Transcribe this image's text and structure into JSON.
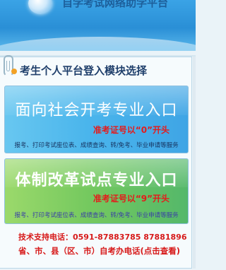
{
  "header": {
    "banner_text": "自学考试网络助学平台"
  },
  "page": {
    "title": "考生个人平台登入模块选择"
  },
  "modules": [
    {
      "title": "面向社会开考专业入口",
      "hint": "准考证号以“0”开头",
      "services": "报考、打印考试座位表、成绩查询、转/免考、毕业申请等服务"
    },
    {
      "title": "体制改革试点专业入口",
      "hint": "准考证号以“9”开头",
      "services": "报考、打印考试座位表、成绩查询、转/免考、毕业申请等服务"
    }
  ],
  "footer": {
    "support": "技术支持电话：0591-87883785 87881896",
    "office_link": "省、市、县（区、市）自考办电话(点击查看)"
  },
  "colors": {
    "header_blue": "#2a8fd6",
    "module1_blue": "#4ab5ec",
    "module2_green": "#75c95f",
    "hint_red": "#e51b1b",
    "title_navy": "#1f3f6b"
  },
  "icons": [
    "globe-logo-icon",
    "paperclip-icon",
    "bullet-dot-icon"
  ]
}
